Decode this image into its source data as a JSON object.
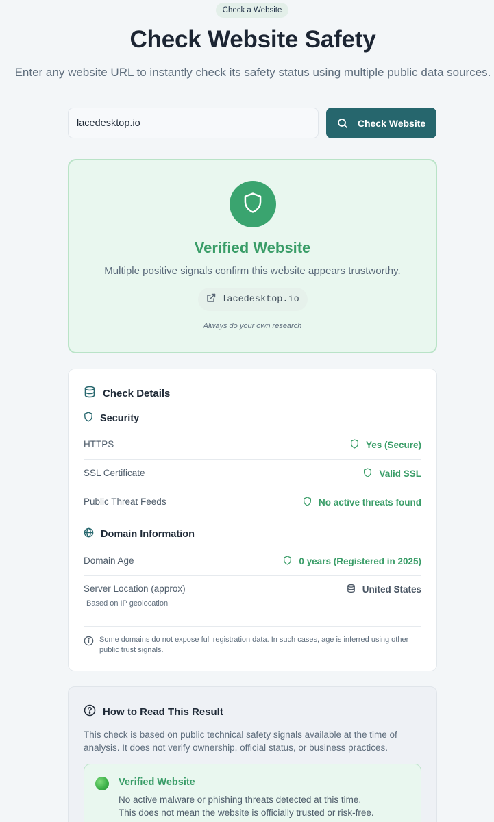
{
  "header": {
    "pill_label": "Check a Website",
    "title": "Check Website Safety",
    "subtitle": "Enter any website URL to instantly check its safety status using multiple public data sources."
  },
  "search": {
    "value": "lacedesktop.io",
    "button_label": "Check Website",
    "button_icon": "search-icon"
  },
  "result": {
    "status_title": "Verified Website",
    "description": "Multiple positive signals confirm this website appears trustworthy.",
    "domain": "lacedesktop.io",
    "note": "Always do your own research",
    "status_color": "#3aa46f"
  },
  "details": {
    "title": "Check Details",
    "security": {
      "heading": "Security",
      "rows": [
        {
          "label": "HTTPS",
          "value": "Yes (Secure)"
        },
        {
          "label": "SSL Certificate",
          "value": "Valid SSL"
        },
        {
          "label": "Public Threat Feeds",
          "value": "No active threats found"
        }
      ]
    },
    "domain_info": {
      "heading": "Domain Information",
      "age_label": "Domain Age",
      "age_value": "0 years (Registered in 2025)",
      "location_label": "Server Location (approx)",
      "location_sub": "Based on IP geolocation",
      "location_value": "United States"
    },
    "note": "Some domains do not expose full registration data. In such cases, age is inferred using other public trust signals."
  },
  "howto": {
    "title": "How to Read This Result",
    "description": "This check is based on public technical safety signals available at the time of analysis. It does not verify ownership, official status, or business practices.",
    "legend": {
      "title": "Verified Website",
      "line1": "No active malware or phishing threats detected at this time.",
      "line2": "This does not mean the website is officially trusted or risk-free."
    }
  },
  "colors": {
    "accent": "#26666d",
    "success": "#3a9d68",
    "background": "#f3f6f8"
  }
}
